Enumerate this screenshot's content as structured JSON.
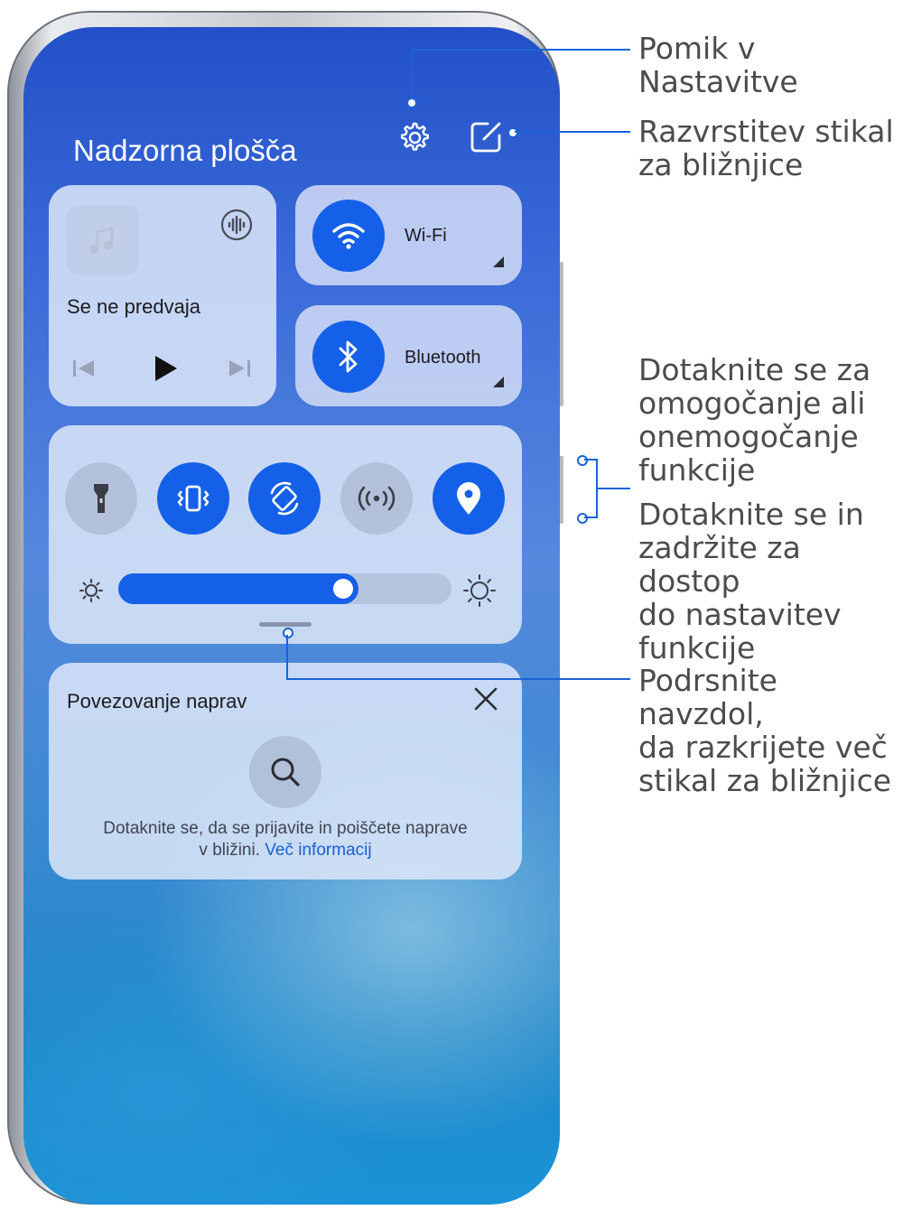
{
  "panel": {
    "title": "Nadzorna plošča"
  },
  "media": {
    "status": "Se ne predvaja"
  },
  "tiles": {
    "wifi_label": "Wi-Fi",
    "bluetooth_label": "Bluetooth"
  },
  "toggles": [
    {
      "icon": "flashlight-icon",
      "active": false
    },
    {
      "icon": "vibrate-icon",
      "active": true
    },
    {
      "icon": "auto-rotate-icon",
      "active": true
    },
    {
      "icon": "hotspot-icon",
      "active": false
    },
    {
      "icon": "location-icon",
      "active": true
    }
  ],
  "brightness": {
    "level": 0.72
  },
  "device_connect": {
    "title": "Povezovanje naprav",
    "desc_line1": "Dotaknite se, da se prijavite in poiščete naprave",
    "desc_line2": "v bližini.",
    "more_link": "Več informacij"
  },
  "callouts": {
    "settings": "Pomik v Nastavitve",
    "sort_l1": "Razvrstitev stikal",
    "sort_l2": "za bližnjice",
    "tap_l1": "Dotaknite se za",
    "tap_l2": "omogočanje ali",
    "tap_l3": "onemogočanje",
    "tap_l4": "funkcije",
    "hold_l1": "Dotaknite se in",
    "hold_l2": "zadržite za dostop",
    "hold_l3": "do nastavitev",
    "hold_l4": "funkcije",
    "swipe_l1": "Podrsnite navzdol,",
    "swipe_l2": "da razkrijete več",
    "swipe_l3": "stikal za bližnjice"
  },
  "colors": {
    "accent": "#1460e8",
    "callout": "#1a63d6",
    "link": "#1a5fd0"
  }
}
